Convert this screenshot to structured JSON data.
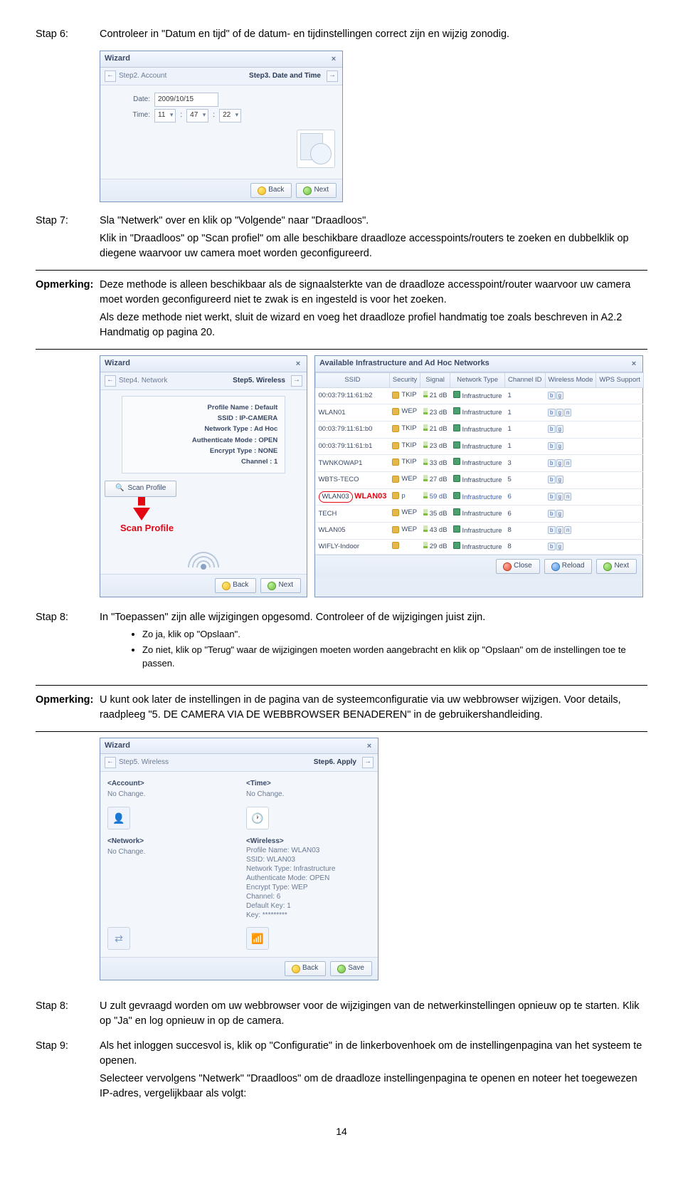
{
  "page_number": "14",
  "step6": {
    "label": "Stap 6:",
    "text": "Controleer in \"Datum en tijd\" of de datum- en tijdinstellingen correct zijn en wijzig zonodig."
  },
  "wizard1": {
    "title": "Wizard",
    "prev": "Step2. Account",
    "current": "Step3. Date and Time",
    "date_label": "Date:",
    "date_value": "2009/10/15",
    "time_label": "Time:",
    "time_h": "11",
    "time_m": "47",
    "time_s": "22",
    "back": "Back",
    "next": "Next"
  },
  "step7": {
    "label": "Stap 7:",
    "para1": "Sla \"Netwerk\" over en klik op \"Volgende\" naar \"Draadloos\".",
    "para2": "Klik in \"Draadloos\" op \"Scan profiel\" om alle beschikbare draadloze accesspoints/routers te zoeken en dubbelklik op diegene waarvoor uw camera moet worden geconfigureerd."
  },
  "opm1": {
    "label": "Opmerking:",
    "para1": "Deze methode is alleen beschikbaar als de signaalsterkte van de draadloze accesspoint/router waarvoor uw camera moet worden geconfigureerd niet te zwak is en ingesteld is voor het zoeken.",
    "para2": "Als deze methode niet werkt, sluit de wizard en voeg het draadloze profiel handmatig toe zoals beschreven in A2.2 Handmatig op pagina 20."
  },
  "wizard2": {
    "title": "Wizard",
    "prev": "Step4. Network",
    "current": "Step5. Wireless",
    "profile": {
      "profile_name": "Profile Name : Default",
      "ssid": "SSID : IP-CAMERA",
      "network_type": "Network Type : Ad Hoc",
      "auth_mode": "Authenticate Mode : OPEN",
      "encrypt_type": "Encrypt Type : NONE",
      "channel": "Channel : 1"
    },
    "scan_profile_btn": "Scan Profile",
    "scan_profile_caption": "Scan Profile",
    "back": "Back",
    "next": "Next"
  },
  "networks": {
    "title": "Available Infrastructure and Ad Hoc Networks",
    "headers": {
      "ssid": "SSID",
      "security": "Security",
      "signal": "Signal",
      "nettype": "Network Type",
      "channel": "Channel ID",
      "wmode": "Wireless Mode",
      "wps": "WPS Support"
    },
    "rows": [
      {
        "ssid": "00:03:79:11:61:b2",
        "sec": "TKIP",
        "sig": "21 dB",
        "nt": "Infrastructure",
        "ch": "1",
        "wm": "b g",
        "wps": ""
      },
      {
        "ssid": "WLAN01",
        "sec": "WEP",
        "sig": "23 dB",
        "nt": "Infrastructure",
        "ch": "1",
        "wm": "b g n",
        "wps": ""
      },
      {
        "ssid": "00:03:79:11:61:b0",
        "sec": "TKIP",
        "sig": "21 dB",
        "nt": "Infrastructure",
        "ch": "1",
        "wm": "b g",
        "wps": ""
      },
      {
        "ssid": "00:03:79:11:61:b1",
        "sec": "TKIP",
        "sig": "23 dB",
        "nt": "Infrastructure",
        "ch": "1",
        "wm": "b g",
        "wps": ""
      },
      {
        "ssid": "TWNKOWAP1",
        "sec": "TKIP",
        "sig": "33 dB",
        "nt": "Infrastructure",
        "ch": "3",
        "wm": "b g n",
        "wps": ""
      },
      {
        "ssid": "WBTS-TECO",
        "sec": "WEP",
        "sig": "27 dB",
        "nt": "Infrastructure",
        "ch": "5",
        "wm": "b g",
        "wps": ""
      },
      {
        "ssid": "WLAN03",
        "sec": "p",
        "sig": "59 dB",
        "nt": "Infrastructure",
        "ch": "6",
        "wm": "b g n",
        "wps": "",
        "selected": true,
        "big": "WLAN03"
      },
      {
        "ssid": "TECH",
        "sec": "WEP",
        "sig": "35 dB",
        "nt": "Infrastructure",
        "ch": "6",
        "wm": "b g",
        "wps": ""
      },
      {
        "ssid": "WLAN05",
        "sec": "WEP",
        "sig": "43 dB",
        "nt": "Infrastructure",
        "ch": "8",
        "wm": "b g n",
        "wps": ""
      },
      {
        "ssid": "WIFLY-Indoor",
        "sec": "",
        "sig": "29 dB",
        "nt": "Infrastructure",
        "ch": "8",
        "wm": "b g",
        "wps": ""
      }
    ],
    "close": "Close",
    "reload": "Reload",
    "next": "Next"
  },
  "step8": {
    "label": "Stap 8:",
    "para1": "In \"Toepassen\" zijn alle wijzigingen opgesomd. Controleer of de wijzigingen juist zijn.",
    "b1": "Zo ja, klik op \"Opslaan\".",
    "b2": "Zo niet, klik op \"Terug\" waar de wijzigingen moeten worden aangebracht en klik op \"Opslaan\" om de instellingen toe te passen."
  },
  "opm2": {
    "label": "Opmerking:",
    "para1": "U kunt ook later de instellingen in de pagina van de systeemconfiguratie via uw webbrowser wijzigen. Voor details, raadpleeg \"5. DE CAMERA VIA DE WEBBROWSER BENADEREN\" in de gebruikershandleiding."
  },
  "wizard3": {
    "title": "Wizard",
    "prev": "Step5. Wireless",
    "current": "Step6. Apply",
    "account_h": "<Account>",
    "account_v": "No Change.",
    "time_h": "<Time>",
    "time_v": "No Change.",
    "network_h": "<Network>",
    "network_v": "No Change.",
    "wireless_h": "<Wireless>",
    "wireless": {
      "l1": "Profile Name: WLAN03",
      "l2": "SSID: WLAN03",
      "l3": "Network Type: Infrastructure",
      "l4": "Authenticate Mode: OPEN",
      "l5": "Encrypt Type: WEP",
      "l6": "Channel: 6",
      "l7": "Default Key: 1",
      "l8": "Key: *********"
    },
    "back": "Back",
    "save": "Save"
  },
  "step8b": {
    "label": "Stap 8:",
    "para1": "U zult gevraagd worden om uw webbrowser voor de wijzigingen van de netwerkinstellingen opnieuw op te starten. Klik op \"Ja\" en log opnieuw in op de camera."
  },
  "step9": {
    "label": "Stap 9:",
    "para1": "Als het inloggen succesvol is, klik op \"Configuratie\" in de linkerbovenhoek om de instellingenpagina van het systeem te openen.",
    "para2": "Selecteer vervolgens \"Netwerk\"  \"Draadloos\" om de draadloze instellingenpagina te openen en noteer het toegewezen IP-adres, vergelijkbaar als volgt:"
  }
}
